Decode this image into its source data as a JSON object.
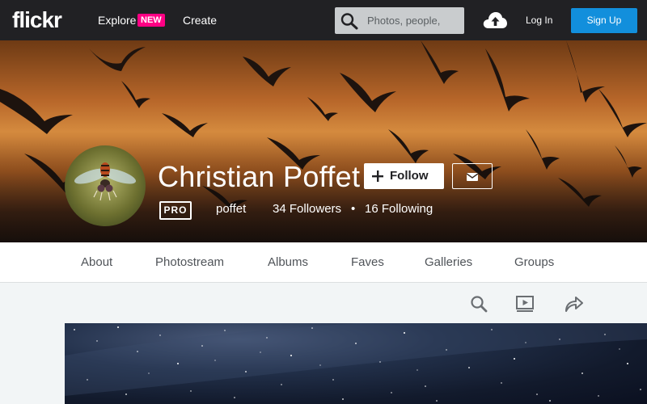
{
  "header": {
    "logo": "flickr",
    "explore_label": "Explore",
    "new_badge": "NEW",
    "create_label": "Create",
    "search_placeholder": "Photos, people,",
    "login_label": "Log In",
    "signup_label": "Sign Up",
    "icons": {
      "search": "search-icon",
      "upload": "cloud-upload-icon"
    },
    "colors": {
      "bar": "#212124",
      "new_badge": "#ff0084",
      "signup": "#128fdc"
    }
  },
  "profile": {
    "name": "Christian Poffet",
    "follow_label": "Follow",
    "pro_label": "PRO",
    "username": "poffet",
    "followers": "34 Followers",
    "separator": "•",
    "following": "16 Following",
    "icons": {
      "follow": "plus-icon",
      "message": "mail-icon"
    }
  },
  "subnav": {
    "items": [
      {
        "label": "About"
      },
      {
        "label": "Photostream"
      },
      {
        "label": "Albums"
      },
      {
        "label": "Faves"
      },
      {
        "label": "Galleries"
      },
      {
        "label": "Groups"
      }
    ]
  },
  "toolbar": {
    "icons": [
      "search-icon",
      "slideshow-icon",
      "share-icon"
    ]
  }
}
